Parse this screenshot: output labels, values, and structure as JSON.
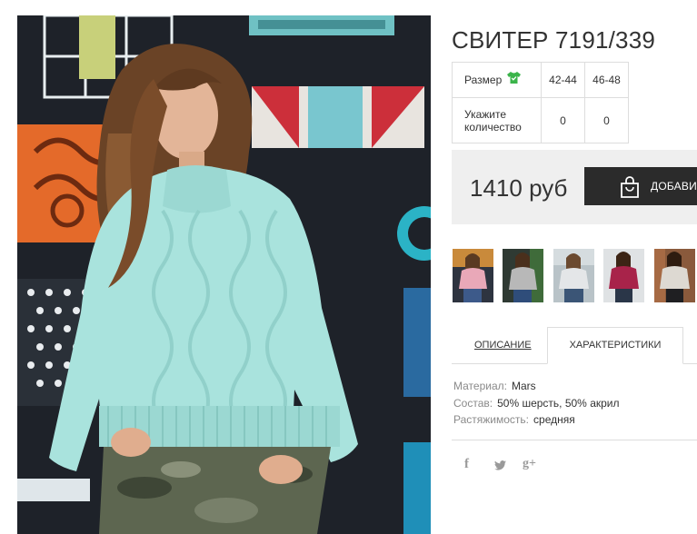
{
  "product": {
    "title": "СВИТЕР 7191/339"
  },
  "size_table": {
    "size_label": "Размер",
    "size_icon": "green-shirt-icon",
    "quantity_label_1": "Укажите",
    "quantity_label_2": "количество",
    "sizes": [
      "42-44",
      "46-48"
    ],
    "quantities": [
      "0",
      "0"
    ]
  },
  "price": {
    "value": "1410 руб",
    "add_button_label": "ДОБАВИТ"
  },
  "thumbnails": [
    {
      "name": "thumb-pink-sweater",
      "color": "#e9a8b8"
    },
    {
      "name": "thumb-grey-sweater",
      "color": "#b8b8b8"
    },
    {
      "name": "thumb-white-sweater",
      "color": "#e4e6e8"
    },
    {
      "name": "thumb-magenta-sweater",
      "color": "#a8234a"
    },
    {
      "name": "thumb-beige-sweater",
      "color": "#ddd9d2"
    }
  ],
  "tabs": {
    "description": "ОПИСАНИЕ",
    "characteristics": "ХАРАКТЕРИСТИКИ"
  },
  "specs": {
    "material_key": "Материал:",
    "material_val": "Mars",
    "composition_key": "Состав:",
    "composition_val": "50% шерсть, 50% акрил",
    "stretch_key": "Растяжимость:",
    "stretch_val": "средняя"
  },
  "social": {
    "facebook": "f",
    "twitter": "twitter-icon",
    "googleplus": "g+"
  },
  "colors": {
    "accent_green": "#3bb44a",
    "button_dark": "#2b2b2b",
    "price_bg": "#efefef",
    "sweater_mint": "#a9e3dd"
  }
}
